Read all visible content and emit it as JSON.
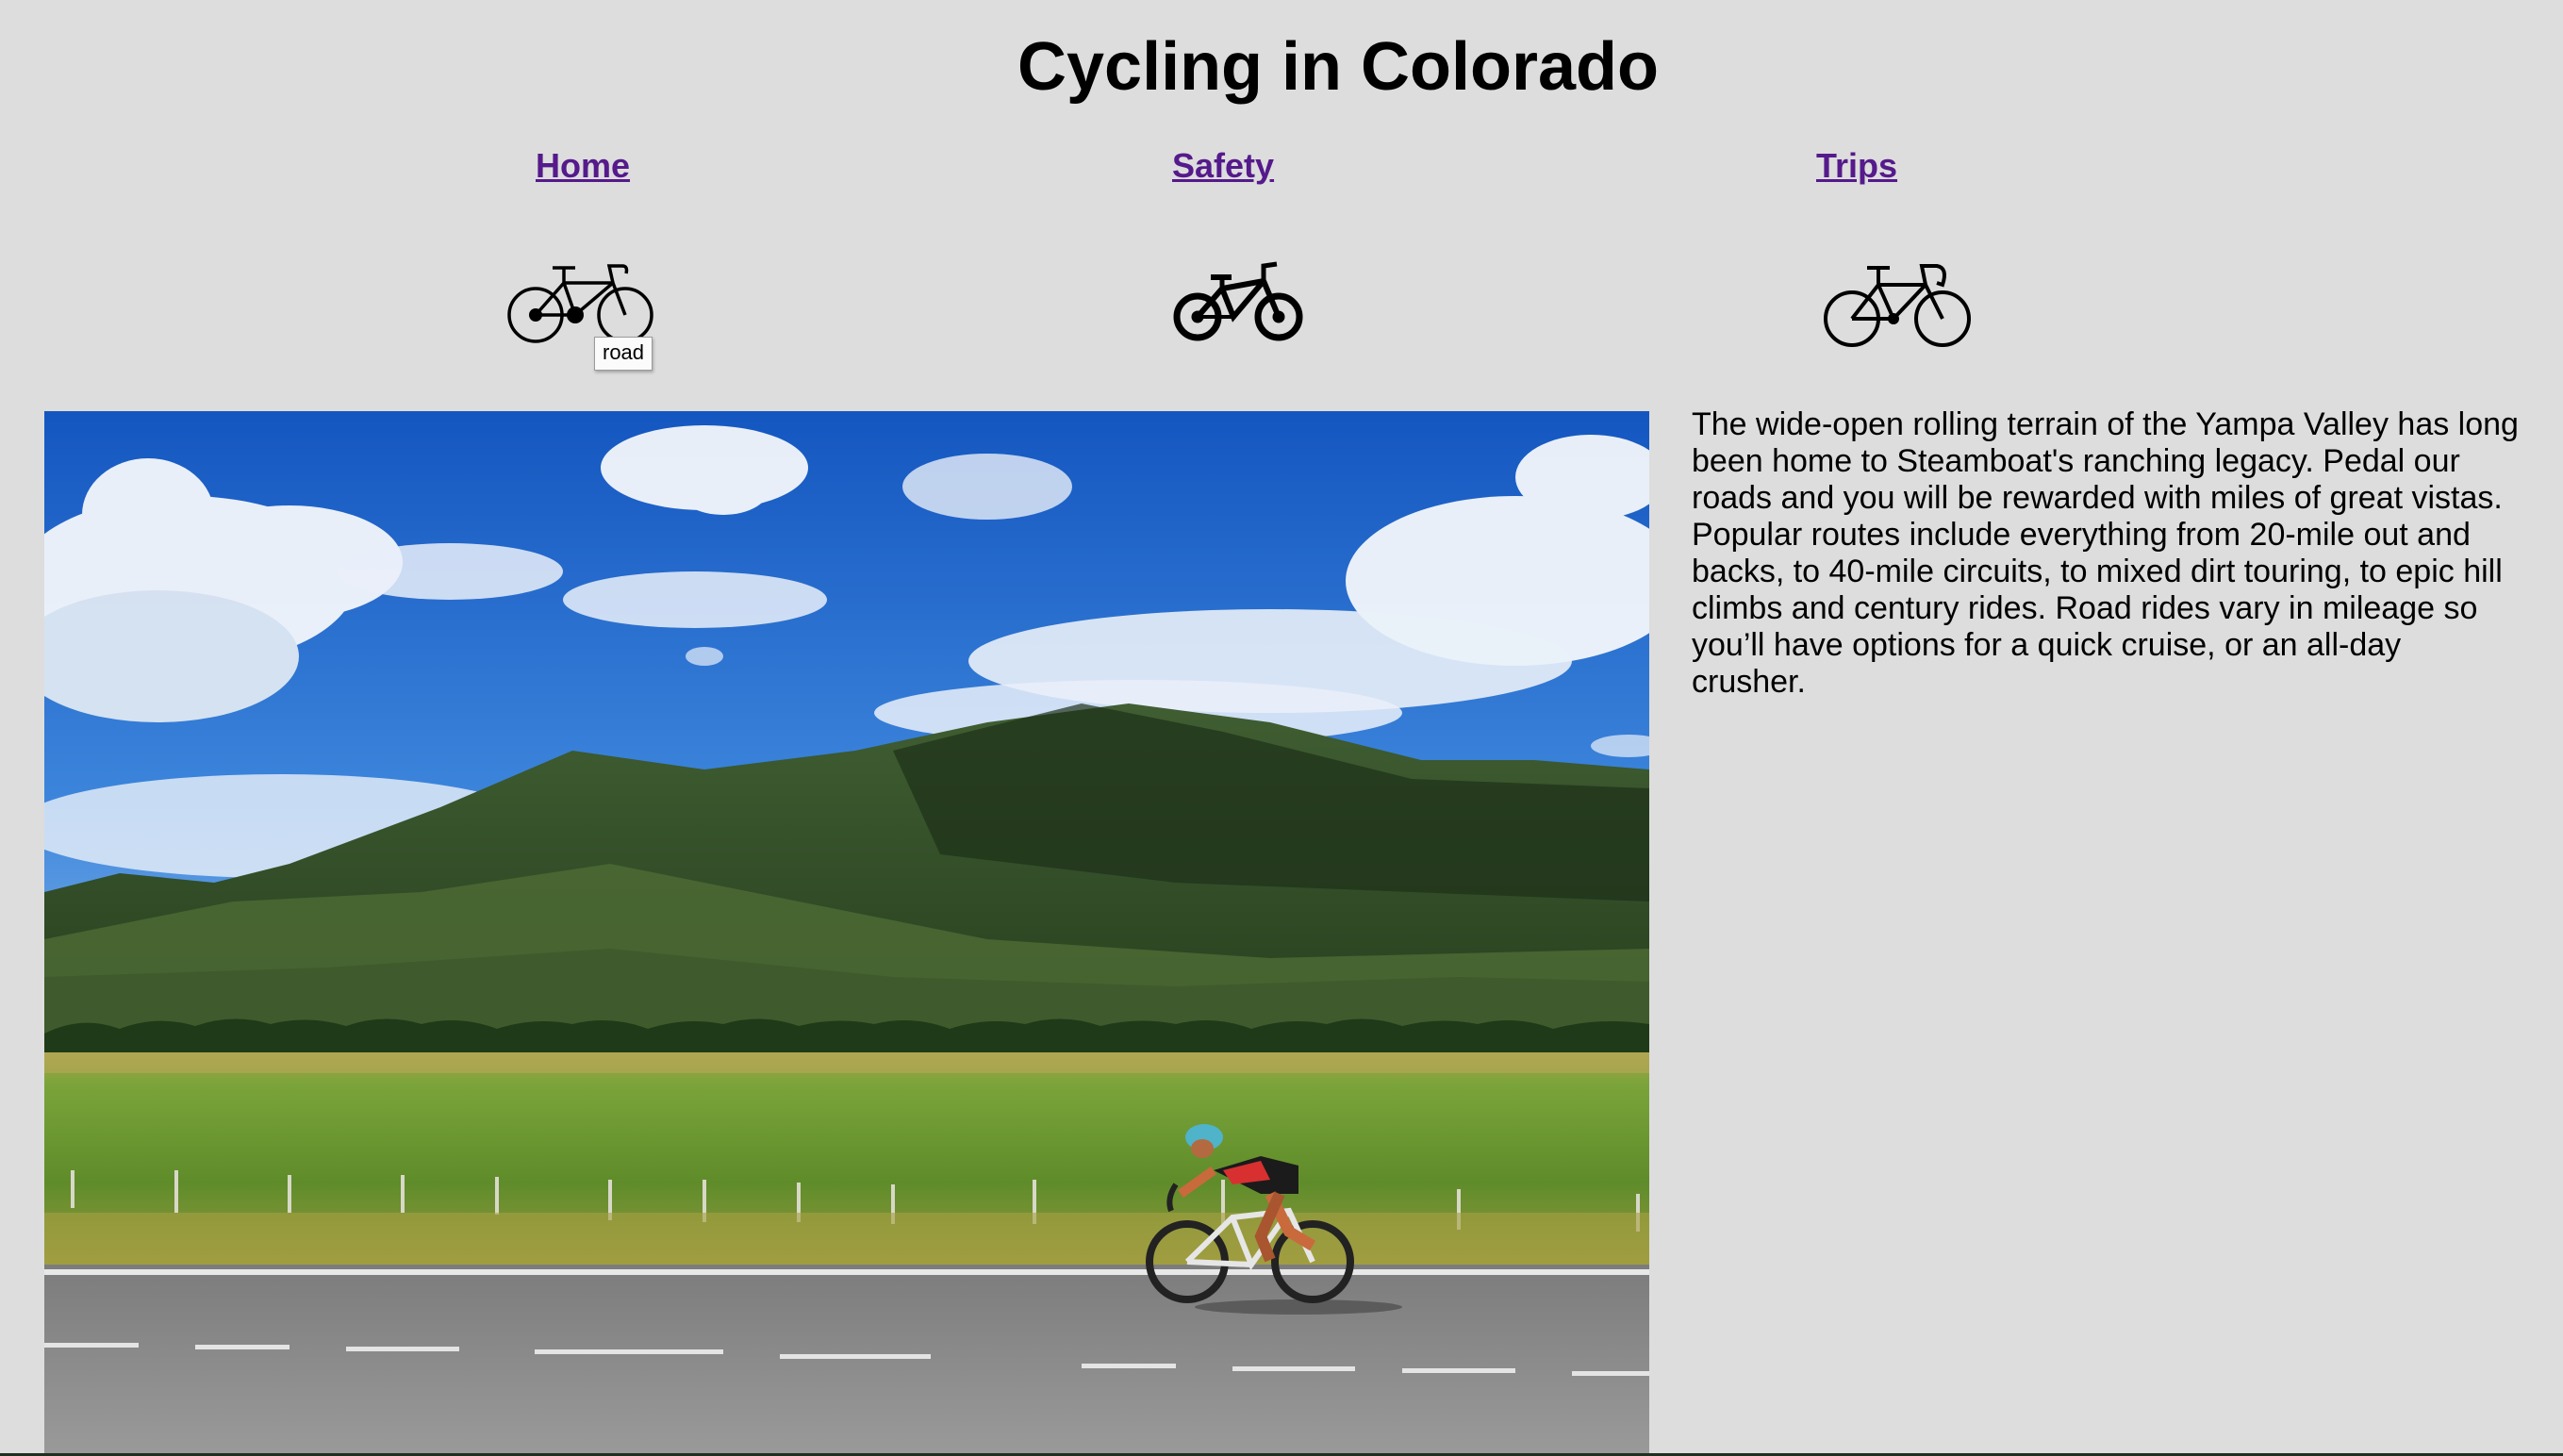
{
  "page": {
    "title": "Cycling in Colorado"
  },
  "nav": {
    "links": [
      {
        "label": "Home"
      },
      {
        "label": "Safety"
      },
      {
        "label": "Trips"
      }
    ],
    "link_color": "#551a8b"
  },
  "bikes": [
    {
      "icon": "road-bike-icon",
      "tooltip": "road"
    },
    {
      "icon": "mountain-bike-icon"
    },
    {
      "icon": "racing-bike-icon"
    }
  ],
  "main": {
    "photo": {
      "icon": "cyclist-photo"
    },
    "description": "The wide-open rolling terrain of the Yampa Valley has long been home to Steamboat's ranching legacy. Pedal our roads and you will be rewarded with miles of great vistas. Popular routes include everything from 20-mile out and backs, to 40-mile circuits, to mixed dirt touring, to epic hill climbs and century rides. Road rides vary in mileage so you’ll have options for a quick cruise, or an all-day crusher."
  },
  "colors": {
    "background": "#dddddd",
    "sky": "#1f63c9",
    "grass": "#6c9a2e",
    "road": "#8a8a8a"
  }
}
